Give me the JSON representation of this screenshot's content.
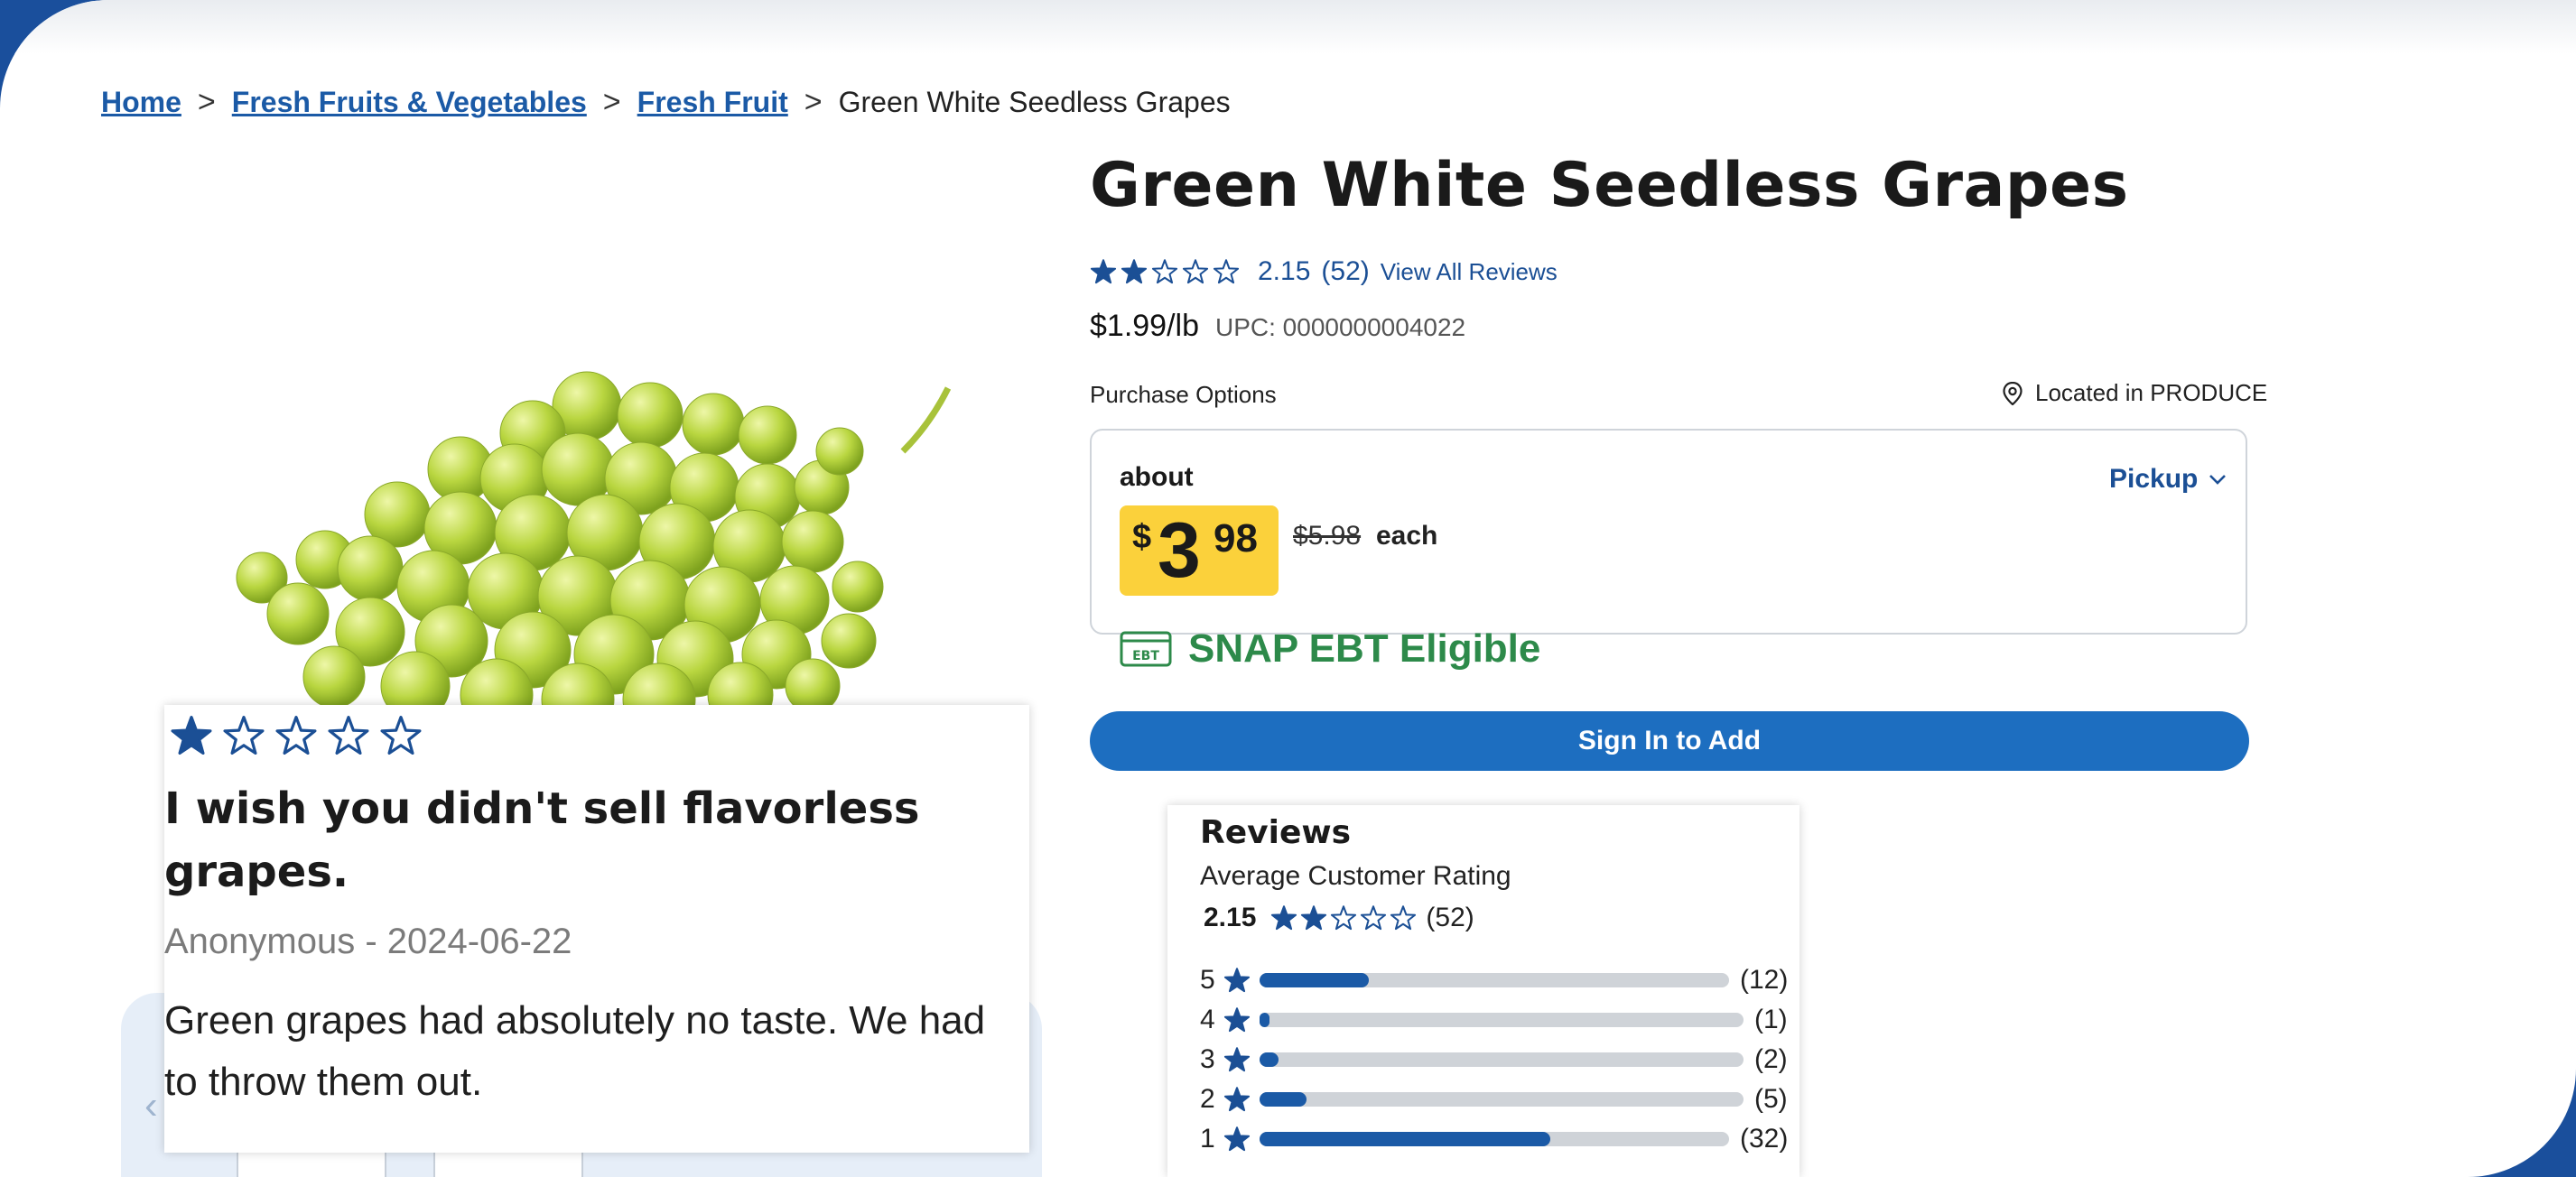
{
  "breadcrumb": {
    "home": "Home",
    "category": "Fresh Fruits & Vegetables",
    "subcategory": "Fresh Fruit",
    "current": "Green White Seedless Grapes",
    "separator": ">"
  },
  "product": {
    "title": "Green White Seedless Grapes",
    "rating_value": 2.15,
    "rating_text": "2.15",
    "review_count_text": "(52)",
    "view_all_reviews": "View All Reviews",
    "unit_price": "$1.99/lb",
    "upc": "UPC: 0000000004022"
  },
  "purchase": {
    "label": "Purchase Options",
    "location": "Located in PRODUCE",
    "about": "about",
    "price_currency": "$",
    "price_dollars": "3",
    "price_cents": "98",
    "was_price": "$5.98",
    "each": "each",
    "pickup": "Pickup",
    "snap_label": "SNAP EBT Eligible",
    "snap_icon_text": "EBT",
    "sign_in_button": "Sign In to Add"
  },
  "review_popup": {
    "stars": 1,
    "title": "I wish you didn't sell flavorless grapes.",
    "meta": "Anonymous - 2024-06-22",
    "body": "Green grapes had absolutely no taste. We had to throw them out."
  },
  "gallery": {
    "prev": "‹"
  },
  "reviews_summary": {
    "title": "Reviews",
    "avg_label": "Average Customer Rating",
    "avg_text": "2.15",
    "avg_value": 2.15,
    "count_text": "(52)",
    "distribution": [
      {
        "stars": "5",
        "count": 12,
        "count_text": "(12)"
      },
      {
        "stars": "4",
        "count": 1,
        "count_text": "(1)"
      },
      {
        "stars": "3",
        "count": 2,
        "count_text": "(2)"
      },
      {
        "stars": "2",
        "count": 5,
        "count_text": "(5)"
      },
      {
        "stars": "1",
        "count": 32,
        "count_text": "(32)"
      }
    ]
  },
  "colors": {
    "brand_blue": "#1b5aa6",
    "button_blue": "#1d6ec0",
    "price_yellow": "#fbd13b",
    "snap_green": "#2d8a4a"
  }
}
